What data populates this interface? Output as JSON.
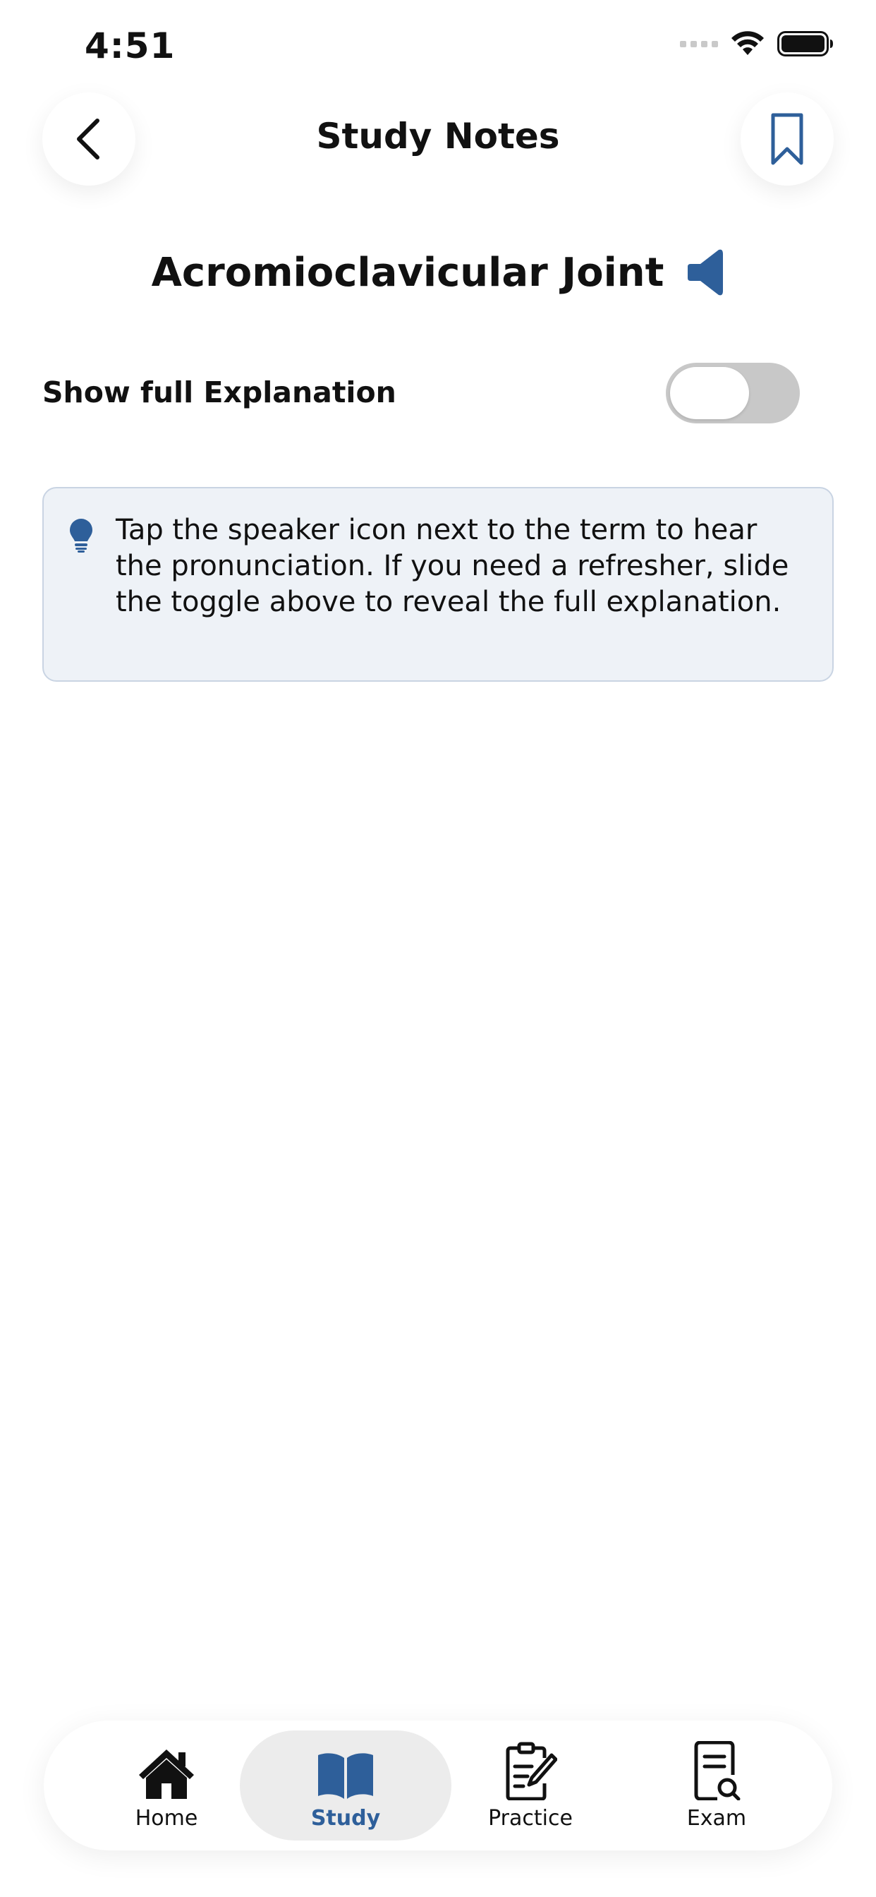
{
  "status_bar": {
    "time": "4:51"
  },
  "header": {
    "title": "Study Notes",
    "back_icon": "chevron-left-icon",
    "bookmark_icon": "bookmark-icon"
  },
  "term": {
    "title": "Acromioclavicular Joint",
    "speaker_icon": "speaker-icon"
  },
  "toggle": {
    "label": "Show full Explanation",
    "value": false
  },
  "tip": {
    "icon": "lightbulb-icon",
    "text": "Tap the speaker icon next to the term to hear the pronunciation. If you need a refresher, slide the toggle above to reveal the full explanation."
  },
  "nav": {
    "items": [
      {
        "label": "Home",
        "icon": "home-icon",
        "active": false
      },
      {
        "label": "Study",
        "icon": "book-icon",
        "active": true
      },
      {
        "label": "Practice",
        "icon": "clipboard-edit-icon",
        "active": false
      },
      {
        "label": "Exam",
        "icon": "document-search-icon",
        "active": false
      }
    ]
  },
  "colors": {
    "accent": "#2e5f9a",
    "tip_background": "#eef2f7",
    "toggle_off": "#c8c8c8"
  }
}
